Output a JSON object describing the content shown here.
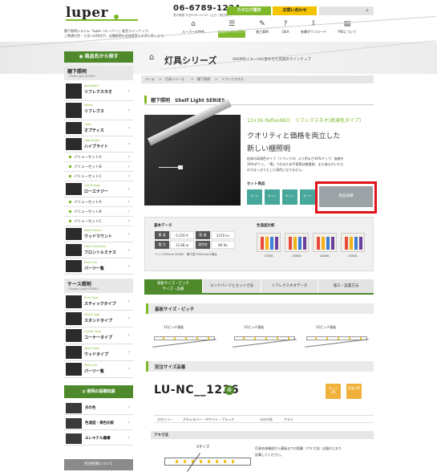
{
  "header": {
    "logo": "luper",
    "tagline1": "棚下照明システム「luper（ルーパー）」販売ラインナップ。",
    "tagline2": "ご希望の色・寸法への特注や、店舗照明の全体提案もお承り致します。",
    "phone": "06-6789-1234",
    "hours": "受付時間 平日9:00〜17:30（土日・祝日除く）",
    "catalog_label": "カタログ請求",
    "contact_label": "お問い合わせ",
    "nav": [
      {
        "icon": "⌂",
        "label": "ルーパーの特長"
      },
      {
        "icon": "☰",
        "label": "照明ラインナップ"
      },
      {
        "icon": "✎",
        "label": "施工事例"
      },
      {
        "icon": "?",
        "label": "Q&A"
      },
      {
        "icon": "⇩",
        "label": "各種ダウンロード"
      },
      {
        "icon": "▤",
        "label": "PSEについて"
      }
    ]
  },
  "sidebar": {
    "head": "商品名から探す",
    "cat1_title": "棚下照明",
    "cat1_sub": "- Shelf Light SERIES -",
    "items": [
      {
        "en": "ReflexNEO",
        "jp": "リフレクスネオ"
      },
      {
        "en": "Reflex",
        "jp": "リフレクス"
      },
      {
        "en": "Optic",
        "jp": "オプティス"
      },
      {
        "en": "High Bright",
        "jp": "ハイブライト"
      }
    ],
    "hb_subs": [
      "バリューセットA",
      "バリューセットB",
      "バリューセットC"
    ],
    "low_energy": {
      "en": "Low Energy",
      "jp": "ローエナジー"
    },
    "le_subs": [
      "バリューセットA",
      "バリューセットB",
      "バリューセットC"
    ],
    "items2": [
      {
        "en": "Wood Mount",
        "jp": "ウッドマウント"
      },
      {
        "en": "Front Luminous",
        "jp": "フロントルミナス"
      },
      {
        "en": "Parts List",
        "jp": "パーツ一覧"
      }
    ],
    "cat2_title": "ケース照明",
    "cat2_sub": "- Display Light SERIES -",
    "items3": [
      {
        "en": "Stick Type",
        "jp": "スティックタイプ"
      },
      {
        "en": "Stand Type",
        "jp": "スタンドタイプ"
      },
      {
        "en": "Corner Type",
        "jp": "コーナータイプ"
      },
      {
        "en": "Wood Type",
        "jp": "ウッドタイプ"
      },
      {
        "en": "Parts List",
        "jp": "パーツ一覧"
      }
    ],
    "head2": "照明の基礎知識",
    "basics": [
      "光の色",
      "色温度・演色比較",
      "エレキテル機構"
    ],
    "foot": "別注照明について"
  },
  "main": {
    "title": "灯具シリーズ",
    "tagline": "SHOPのイメージに合わせた充実のラインナップ",
    "breadcrumb": [
      "ホーム",
      ">",
      "灯具シリーズ",
      ">",
      "棚下照明",
      ">",
      "リフレクスネオ"
    ],
    "section": "棚下照明　Shelf Light SERIES",
    "product_name": "12×36 ReflexNEO　リフレクスネオ(高演色タイプ)",
    "copy1": "クオリティと価格を両立した",
    "copy2": "新しい棚照明",
    "desc": [
      "従来の高演色タイプ（リフレクス）より明るさ30%アップ、価格を",
      "30%ダウン。「黒」で光るため手直節は数量割、また曲ろかいただ",
      "のではっきりとした演色になりません。"
    ],
    "set_label": "セット商品",
    "set_items": [
      "セット",
      "セット",
      "セット",
      "セット"
    ],
    "detail_button": "製品詳細",
    "basic_label": "基本データ",
    "specs": [
      {
        "k": "電 流",
        "v": "0.370 A",
        "k2": "照 度",
        "v2": "2370 Lx"
      },
      {
        "k": "電 力",
        "v": "13.68 w",
        "k2": "演色性",
        "v2": "80 Ra"
      }
    ],
    "spec_note": "ワイド520mm 5000K　棚下直下300mmの場合",
    "color_label": "色温度比較",
    "colors": [
      "2700K",
      "3000K",
      "4000K",
      "5000K"
    ],
    "tabs": [
      "基板サイズ・ピッチ\nサイズ・品番",
      "エンドパーツとカット寸法",
      "リフレクスネオデータ",
      "施工・設置方法"
    ],
    "h_pitch": "基板サイズ・ピッチ",
    "diagrams": [
      "12ピッチ基板",
      "12ピッチ基板",
      "12ピッチ基板"
    ],
    "h_size": "別注サイズ品番",
    "model": "LU-NC__1236",
    "ok_badges": [
      "カット OK",
      "色温 OK"
    ],
    "body_color_label": "本体カラー",
    "body_color": "アルシルバー・ホワイト・ブラック",
    "body_material_label": "本体材質",
    "body_material": "アルミ",
    "aka_head": "アキ寸法",
    "aka_label": "Sサイズ",
    "aka_note1": "灯具本体端部から基板までの距離（アキ寸法）は図のとおり",
    "aka_note2": "計算してください。"
  },
  "colors": {
    "accent": "#7fb92a",
    "dark_green": "#4e8a2b",
    "yellow": "#f5c400",
    "highlight": "#e0121a"
  }
}
